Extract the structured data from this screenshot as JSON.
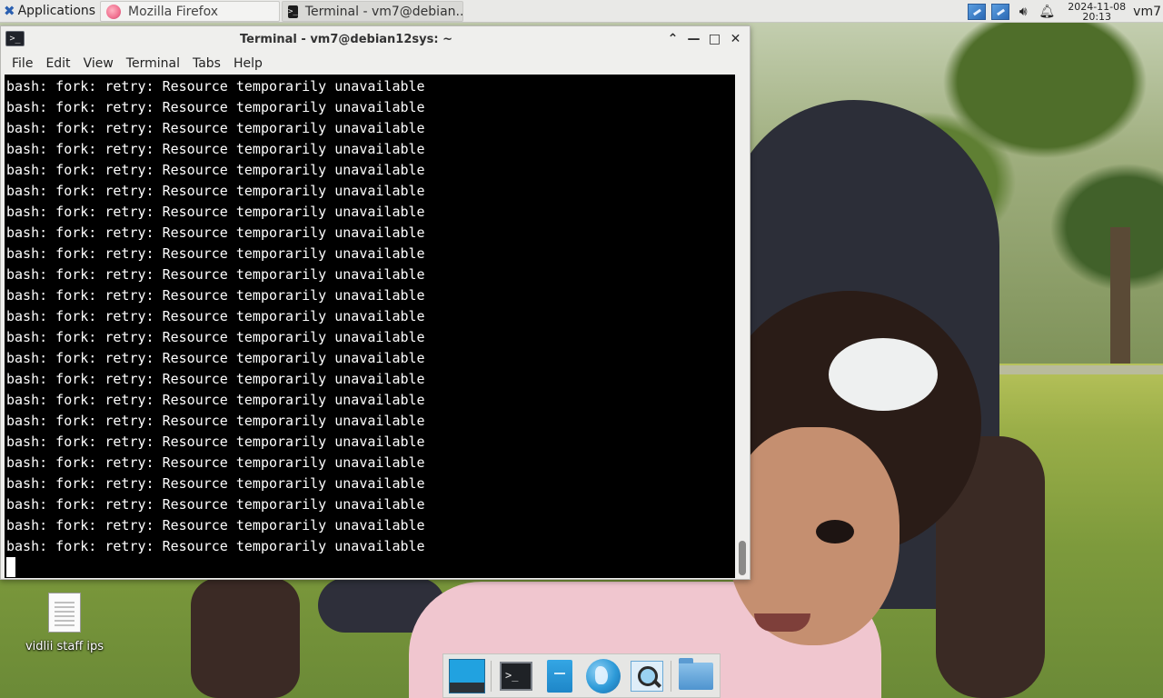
{
  "top_panel": {
    "apps_label": "Applications",
    "apps_icon": "xfce-mouse-icon",
    "tasks": [
      {
        "label": "Mozilla Firefox",
        "icon": "firefox-icon"
      },
      {
        "label": "Terminal - vm7@debian...",
        "icon": "terminal-icon"
      }
    ],
    "clock": {
      "date": "2024-11-08",
      "time": "20:13"
    },
    "user": "vm7"
  },
  "window": {
    "title": "Terminal - vm7@debian12sys: ~",
    "controls": [
      "⌃",
      "—",
      "□",
      "✕"
    ],
    "menu": [
      "File",
      "Edit",
      "View",
      "Terminal",
      "Tabs",
      "Help"
    ],
    "terminal_lines": [
      "bash: fork: retry: Resource temporarily unavailable",
      "bash: fork: retry: Resource temporarily unavailable",
      "bash: fork: retry: Resource temporarily unavailable",
      "bash: fork: retry: Resource temporarily unavailable",
      "bash: fork: retry: Resource temporarily unavailable",
      "bash: fork: retry: Resource temporarily unavailable",
      "bash: fork: retry: Resource temporarily unavailable",
      "bash: fork: retry: Resource temporarily unavailable",
      "bash: fork: retry: Resource temporarily unavailable",
      "bash: fork: retry: Resource temporarily unavailable",
      "bash: fork: retry: Resource temporarily unavailable",
      "bash: fork: retry: Resource temporarily unavailable",
      "bash: fork: retry: Resource temporarily unavailable",
      "bash: fork: retry: Resource temporarily unavailable",
      "bash: fork: retry: Resource temporarily unavailable",
      "bash: fork: retry: Resource temporarily unavailable",
      "bash: fork: retry: Resource temporarily unavailable",
      "bash: fork: retry: Resource temporarily unavailable",
      "bash: fork: retry: Resource temporarily unavailable",
      "bash: fork: retry: Resource temporarily unavailable",
      "bash: fork: retry: Resource temporarily unavailable",
      "bash: fork: retry: Resource temporarily unavailable",
      "bash: fork: retry: Resource temporarily unavailable"
    ]
  },
  "desktop": {
    "icon_label": "vidlii staff ips"
  },
  "dock": {
    "items": [
      "show-desktop-icon",
      "terminal-icon",
      "file-manager-icon",
      "web-browser-icon",
      "app-finder-icon",
      "folder-icon"
    ]
  },
  "colors": {
    "terminal_bg": "#000000",
    "terminal_fg": "#ffffff",
    "panel_bg": "#e9e9e7"
  }
}
